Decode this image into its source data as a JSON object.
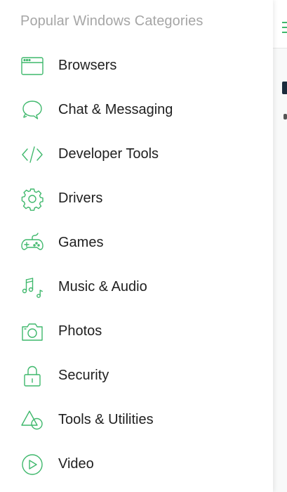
{
  "drawer": {
    "title": "Popular Windows Categories",
    "items": [
      {
        "label": "Browsers",
        "icon": "browser-window-icon"
      },
      {
        "label": "Chat & Messaging",
        "icon": "chat-bubbles-icon"
      },
      {
        "label": "Developer Tools",
        "icon": "code-brackets-icon"
      },
      {
        "label": "Drivers",
        "icon": "gear-icon"
      },
      {
        "label": "Games",
        "icon": "gamepad-icon"
      },
      {
        "label": "Music & Audio",
        "icon": "music-notes-icon"
      },
      {
        "label": "Photos",
        "icon": "camera-icon"
      },
      {
        "label": "Security",
        "icon": "padlock-icon"
      },
      {
        "label": "Tools & Utilities",
        "icon": "shapes-icon"
      },
      {
        "label": "Video",
        "icon": "play-circle-icon"
      }
    ]
  },
  "colors": {
    "accent": "#3fb86c",
    "title": "#a6a6a6",
    "label": "#1f1f1f"
  }
}
